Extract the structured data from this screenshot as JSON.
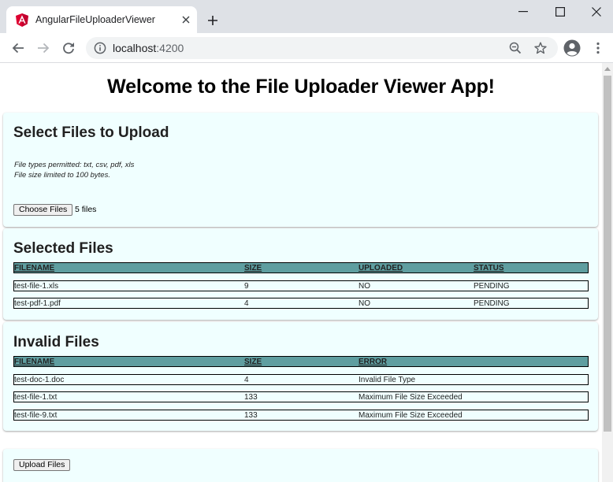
{
  "browser": {
    "tab_title": "AngularFileUploaderViewer",
    "url_host": "localhost",
    "url_port": ":4200",
    "icons": {
      "favicon": "angular-logo-icon",
      "tab_close": "close-icon",
      "new_tab": "plus-icon",
      "back": "back-arrow-icon",
      "forward": "forward-arrow-icon",
      "reload": "reload-icon",
      "site_info": "info-icon",
      "zoom": "zoom-out-icon",
      "bookmark": "star-icon",
      "profile": "profile-icon",
      "menu": "kebab-menu-icon"
    }
  },
  "page": {
    "title": "Welcome to the File Uploader Viewer App!"
  },
  "select_section": {
    "heading": "Select Files to Upload",
    "note_types": "File types permitted: txt, csv, pdf, xls",
    "note_size": "File size limited to 100 bytes.",
    "choose_button": "Choose Files",
    "file_count": "5 files"
  },
  "selected_section": {
    "heading": "Selected Files",
    "columns": [
      "FILENAME",
      "SIZE",
      "UPLOADED",
      "STATUS"
    ],
    "rows": [
      [
        "test-file-1.xls",
        "9",
        "NO",
        "PENDING"
      ],
      [
        "test-pdf-1.pdf",
        "4",
        "NO",
        "PENDING"
      ]
    ]
  },
  "invalid_section": {
    "heading": "Invalid Files",
    "columns": [
      "FILENAME",
      "SIZE",
      "ERROR"
    ],
    "rows": [
      [
        "test-doc-1.doc",
        "4",
        "Invalid File Type"
      ],
      [
        "test-file-1.txt",
        "133",
        "Maximum File Size Exceeded"
      ],
      [
        "test-file-9.txt",
        "133",
        "Maximum File Size Exceeded"
      ]
    ]
  },
  "upload_section": {
    "button": "Upload Files"
  },
  "colors": {
    "card_background": "#f0ffff",
    "table_header": "#5f9ea0",
    "angular_red": "#dd0031"
  }
}
